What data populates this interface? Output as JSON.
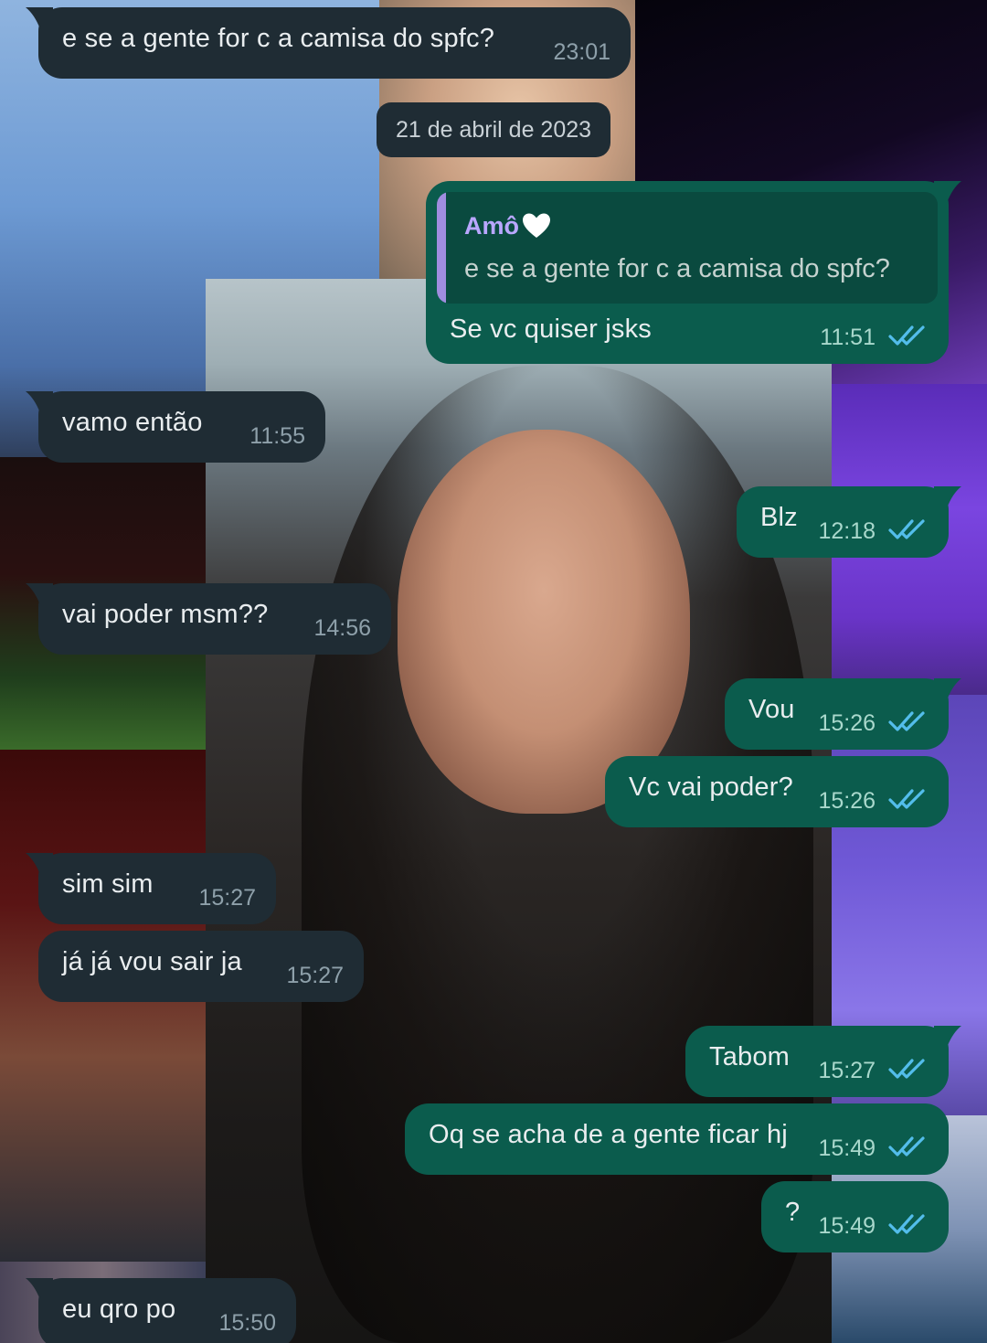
{
  "date_separator": "21 de abril de 2023",
  "quoted": {
    "author": "Amô",
    "text": "e se a gente for c a camisa do spfc?"
  },
  "messages": [
    {
      "dir": "in",
      "text": "e se a gente for c a camisa do spfc?",
      "time": "23:01"
    },
    {
      "dir": "out",
      "text": "Se vc quiser jsks",
      "time": "11:51",
      "status": "read"
    },
    {
      "dir": "in",
      "text": "vamo então",
      "time": "11:55"
    },
    {
      "dir": "out",
      "text": "Blz",
      "time": "12:18",
      "status": "read"
    },
    {
      "dir": "in",
      "text": "vai poder msm??",
      "time": "14:56"
    },
    {
      "dir": "out",
      "text": "Vou",
      "time": "15:26",
      "status": "read"
    },
    {
      "dir": "out",
      "text": "Vc vai poder?",
      "time": "15:26",
      "status": "read"
    },
    {
      "dir": "in",
      "text": "sim sim",
      "time": "15:27"
    },
    {
      "dir": "in",
      "text": "já já vou sair ja",
      "time": "15:27"
    },
    {
      "dir": "out",
      "text": "Tabom",
      "time": "15:27",
      "status": "read"
    },
    {
      "dir": "out",
      "text": "Oq se acha de a gente ficar hj",
      "time": "15:49",
      "status": "read"
    },
    {
      "dir": "out",
      "text": "?",
      "time": "15:49",
      "status": "read"
    },
    {
      "dir": "in",
      "text": "eu qro po",
      "time": "15:50"
    }
  ],
  "icons": {
    "read_receipt": "double-check-icon",
    "quote_heart": "white-heart-icon"
  },
  "colors": {
    "incoming_bubble": "#1f2c34",
    "outgoing_bubble": "#0b5c4d",
    "read_ticks": "#53bdeb",
    "quote_accent": "#a08ddf"
  }
}
